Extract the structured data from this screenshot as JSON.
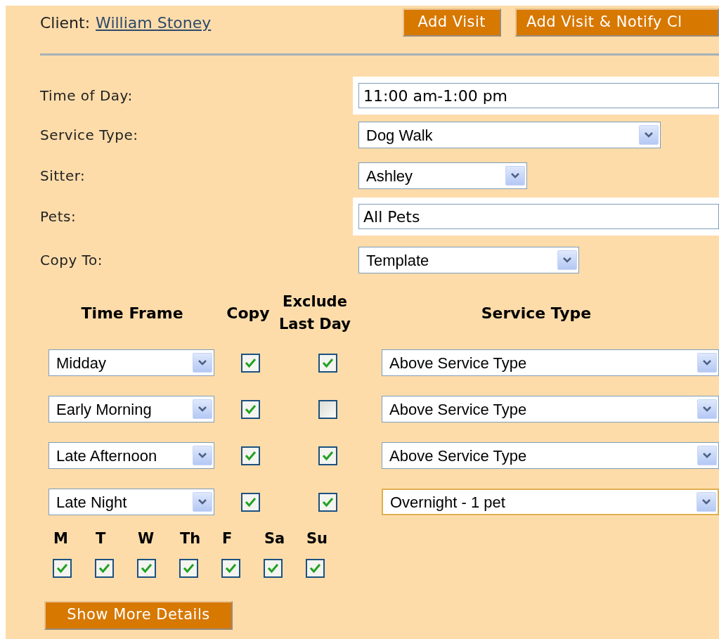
{
  "client": {
    "label": "Client:",
    "name": "William Stoney"
  },
  "buttons": [
    "Add Visit",
    "Add Visit & Notify Cl"
  ],
  "fields": [
    {
      "label": "Time of Day:",
      "kind": "text",
      "value": "11:00 am-1:00 pm"
    },
    {
      "label": "Service Type:",
      "kind": "select",
      "value": "Dog Walk"
    },
    {
      "label": "Sitter:",
      "kind": "select",
      "value": "Ashley"
    },
    {
      "label": "Pets:",
      "kind": "text",
      "value": "All Pets"
    },
    {
      "label": "Copy To:",
      "kind": "select",
      "value": "Template"
    }
  ],
  "schedule": {
    "columns": [
      "Time Frame",
      "Copy",
      "Exclude Last Day",
      "Service Type"
    ],
    "rows": [
      {
        "time_frame": "Midday",
        "copy": true,
        "exclude_last_day": true,
        "service_type": "Above Service Type",
        "focused": false
      },
      {
        "time_frame": "Early Morning",
        "copy": true,
        "exclude_last_day": false,
        "service_type": "Above Service Type",
        "focused": false
      },
      {
        "time_frame": "Late Afternoon",
        "copy": true,
        "exclude_last_day": true,
        "service_type": "Above Service Type",
        "focused": false
      },
      {
        "time_frame": "Late Night",
        "copy": true,
        "exclude_last_day": true,
        "service_type": "Overnight - 1 pet",
        "focused": true
      }
    ]
  },
  "days": [
    {
      "label": "M",
      "checked": true
    },
    {
      "label": "T",
      "checked": true
    },
    {
      "label": "W",
      "checked": true
    },
    {
      "label": "Th",
      "checked": true
    },
    {
      "label": "F",
      "checked": true
    },
    {
      "label": "Sa",
      "checked": true
    },
    {
      "label": "Su",
      "checked": true
    }
  ],
  "details_button": "Show More Details"
}
